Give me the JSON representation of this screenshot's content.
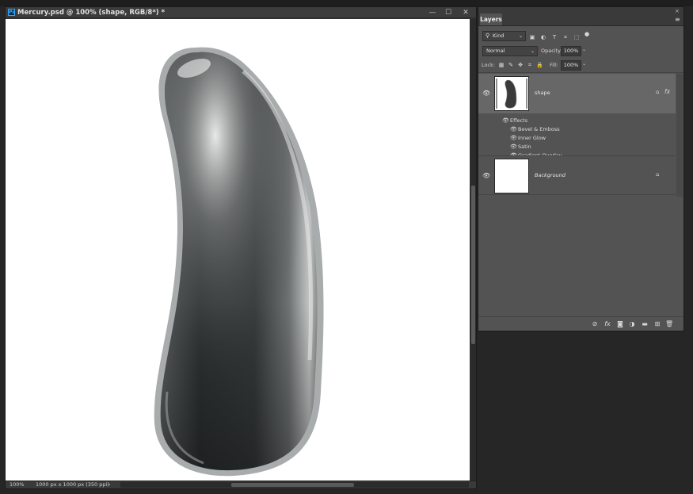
{
  "document": {
    "title": "Mercury.psd @ 100% (shape, RGB/8*) *",
    "app_icon": "Ps",
    "window_buttons": {
      "minimize": "—",
      "maximize": "☐",
      "close": "✕"
    }
  },
  "status_bar": {
    "zoom": "100%",
    "doc_size": "1000 px x 1000 px (350 ppi)",
    "arrow": "›"
  },
  "layers_panel": {
    "tab_label": "Layers",
    "close_glyph": "×",
    "menu_glyph": "≡",
    "filter": {
      "search_glyph": "⚲",
      "kind_label": "Kind",
      "caret": "⌄",
      "filter_icons": [
        "image-filter-icon",
        "adjustment-filter-icon",
        "type-filter-icon",
        "shape-filter-icon",
        "smart-object-filter-icon",
        "filter-toggle-icon"
      ],
      "filter_glyphs": [
        "▣",
        "◐",
        "T",
        "⌗",
        "⬚",
        "●"
      ]
    },
    "blend_mode": "Normal",
    "blend_caret": "⌄",
    "opacity_label": "Opacity:",
    "opacity_value": "100%",
    "opacity_caret": "⌄",
    "lock_label": "Lock:",
    "lock_glyphs": [
      "▦",
      "✎",
      "✥",
      "⌗",
      "🔒"
    ],
    "fill_label": "Fill:",
    "fill_value": "100%",
    "fill_caret": "⌄",
    "eye_glyph": "👁",
    "layers": [
      {
        "name": "shape",
        "selected": true,
        "fx": "fx",
        "lock_glyph": "⌂"
      },
      {
        "name": "Background",
        "selected": false,
        "lock_glyph": "⌂"
      }
    ],
    "effects_header": "Effects",
    "effects": [
      "Bevel & Emboss",
      "Inner Glow",
      "Satin",
      "Gradient Overlay"
    ],
    "footer_glyphs": [
      "⊘",
      "fx",
      "◙",
      "◑",
      "▬",
      "⊞",
      "🗑"
    ]
  },
  "colors": {
    "panel_bg": "#535353",
    "selected_layer": "#676767",
    "app_bg": "#262626",
    "canvas": "#ffffff"
  }
}
